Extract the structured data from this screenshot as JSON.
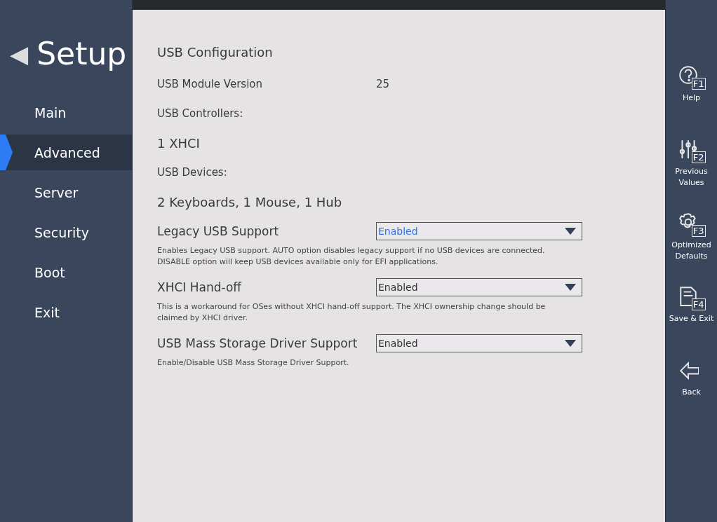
{
  "sidebar": {
    "back_glyph": "◀",
    "title": "Setup",
    "items": [
      {
        "label": "Main",
        "selected": false
      },
      {
        "label": "Advanced",
        "selected": true
      },
      {
        "label": "Server",
        "selected": false
      },
      {
        "label": "Security",
        "selected": false
      },
      {
        "label": "Boot",
        "selected": false
      },
      {
        "label": "Exit",
        "selected": false
      }
    ]
  },
  "content": {
    "heading": "USB Configuration",
    "info": [
      {
        "kind": "pair",
        "label": "USB Module Version",
        "value": "25"
      },
      {
        "kind": "label",
        "label": "USB Controllers:"
      },
      {
        "kind": "big",
        "label": "1 XHCI"
      },
      {
        "kind": "label",
        "label": "USB Devices:"
      },
      {
        "kind": "big",
        "label": "2 Keyboards, 1 Mouse, 1 Hub"
      }
    ],
    "settings": [
      {
        "label": "Legacy USB Support",
        "value": "Enabled",
        "selected": true,
        "description": "Enables Legacy USB support. AUTO option disables legacy support if no USB devices are connected. DISABLE option will keep USB devices available only for EFI applications."
      },
      {
        "label": "XHCI Hand-off",
        "value": "Enabled",
        "selected": false,
        "description": "This is a workaround for OSes without XHCI hand-off support. The XHCI ownership change should be claimed by XHCI driver."
      },
      {
        "label": "USB Mass Storage Driver Support",
        "value": "Enabled",
        "selected": false,
        "description": "Enable/Disable USB Mass Storage Driver Support."
      }
    ]
  },
  "function_keys": [
    {
      "kind": "help",
      "key": "F1",
      "label": "Help"
    },
    {
      "kind": "sliders",
      "key": "F2",
      "label": "Previous Values"
    },
    {
      "kind": "gear",
      "key": "F3",
      "label": "Optimized Defaults"
    },
    {
      "kind": "save",
      "key": "F4",
      "label": "Save & Exit"
    },
    {
      "kind": "back",
      "label": "Back"
    }
  ]
}
